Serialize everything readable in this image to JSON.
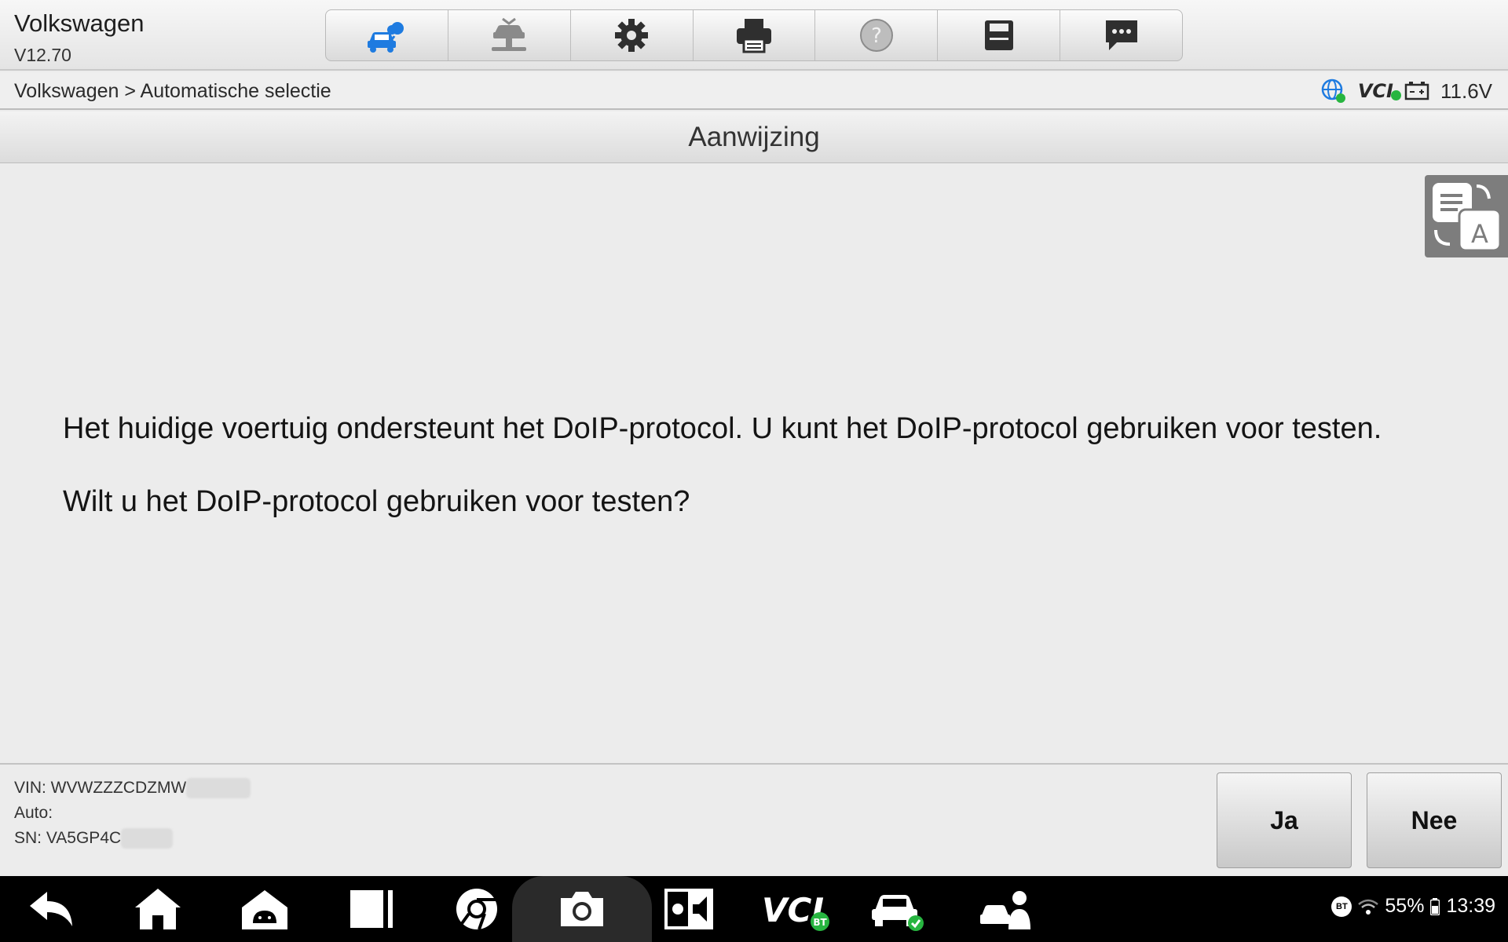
{
  "header": {
    "app_name": "Volkswagen",
    "version": "V12.70",
    "toolbar": [
      {
        "name": "car-cloud-icon",
        "active": true
      },
      {
        "name": "car-lift-icon",
        "active": false
      },
      {
        "name": "gear-icon",
        "active": false
      },
      {
        "name": "printer-icon",
        "active": false
      },
      {
        "name": "help-icon",
        "active": false
      },
      {
        "name": "save-icon",
        "active": false
      },
      {
        "name": "chat-icon",
        "active": false
      }
    ]
  },
  "breadcrumb": "Volkswagen > Automatische selectie",
  "status": {
    "vci_label": "VCI",
    "voltage": "11.6V"
  },
  "title": "Aanwijzing",
  "message": {
    "line1": "Het huidige voertuig ondersteunt het DoIP-protocol. U kunt het DoIP-protocol gebruiken voor testen.",
    "line2": "Wilt u het DoIP-protocol gebruiken voor testen?"
  },
  "vehicle": {
    "vin": "VIN: WVWZZZCDZMW",
    "auto": "Auto:",
    "sn": "SN: VA5GP4C"
  },
  "buttons": {
    "yes": "Ja",
    "no": "Nee"
  },
  "navbar": {
    "vci_label": "VCI",
    "bt_label": "BT",
    "battery": "55%",
    "time": "13:39"
  },
  "colors": {
    "accent_blue": "#1e7be0",
    "ok_green": "#27b540"
  }
}
